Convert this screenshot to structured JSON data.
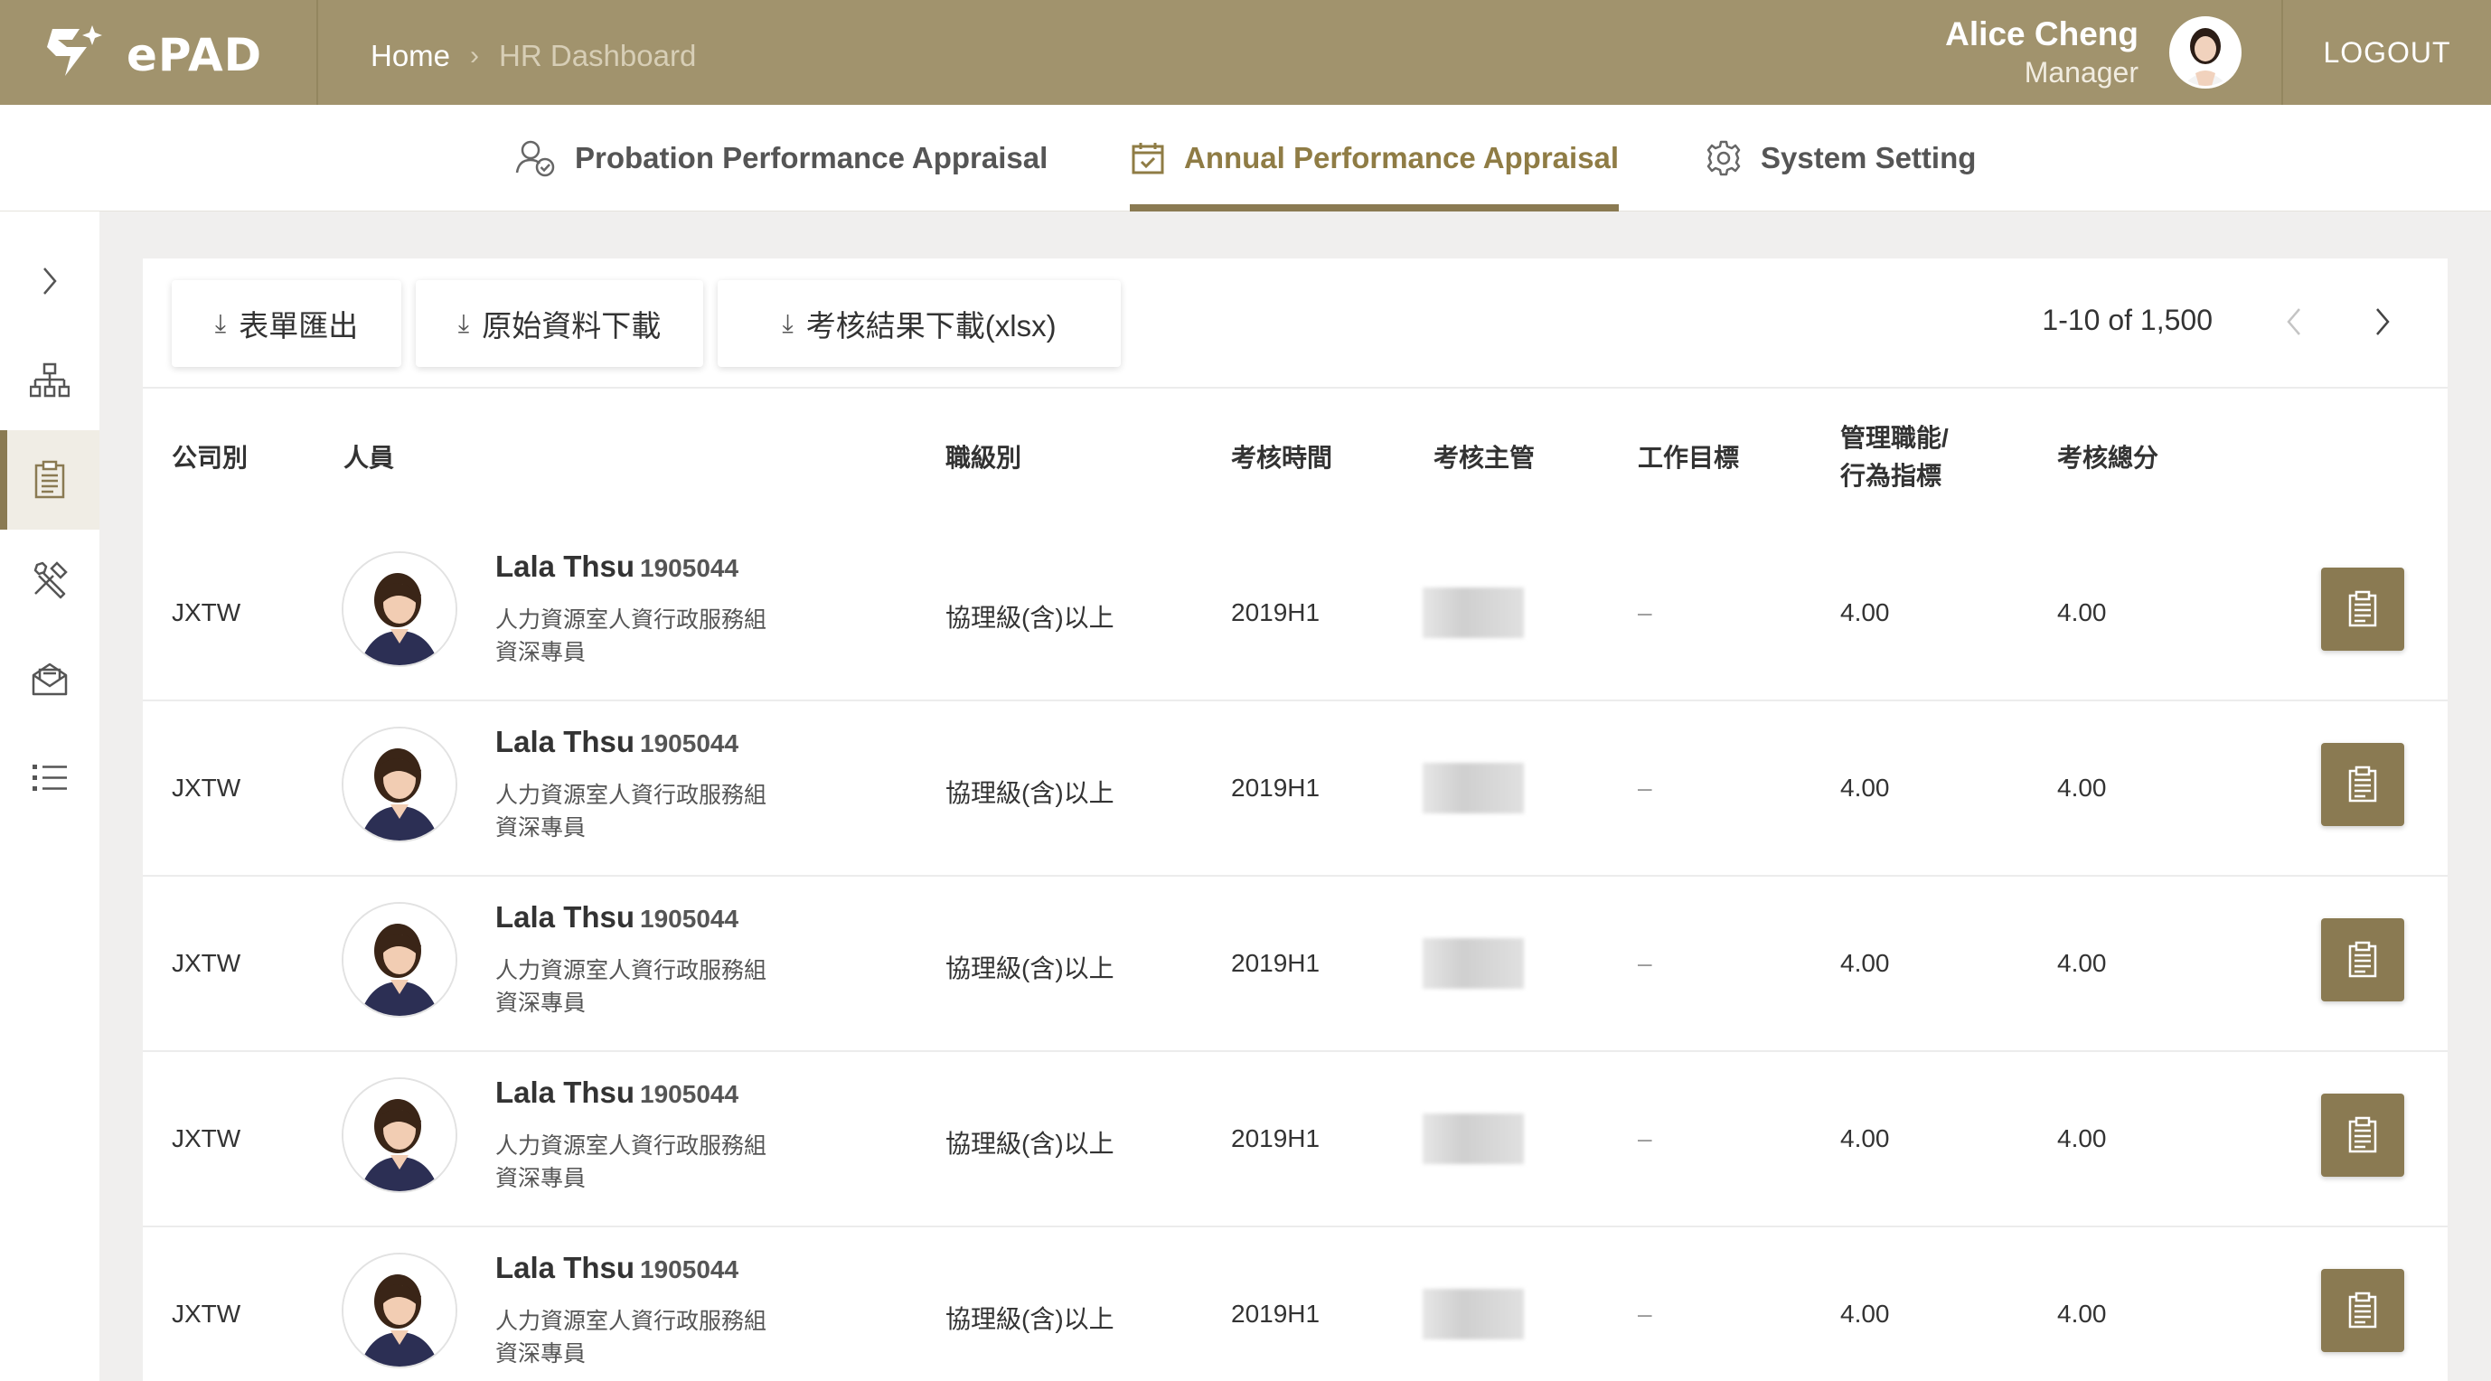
{
  "header": {
    "logo_text": "ePAD",
    "breadcrumb": {
      "home": "Home",
      "current": "HR Dashboard"
    },
    "user": {
      "name": "Alice Cheng",
      "role": "Manager"
    },
    "logout_label": "LOGOUT",
    "colors": {
      "brand": "#a1936d",
      "accent": "#8a7a52"
    }
  },
  "tabs": [
    {
      "label": "Probation Performance Appraisal",
      "icon": "user-check-icon"
    },
    {
      "label": "Annual Performance Appraisal",
      "icon": "calendar-check-icon",
      "active": true
    },
    {
      "label": "System Setting",
      "icon": "gear-icon"
    }
  ],
  "sidebar": {
    "items": [
      {
        "icon": "chevron-right-icon"
      },
      {
        "icon": "org-chart-icon"
      },
      {
        "icon": "clipboard-icon",
        "active": true
      },
      {
        "icon": "tools-icon"
      },
      {
        "icon": "mail-open-icon"
      },
      {
        "icon": "list-icon"
      }
    ]
  },
  "toolbar": {
    "buttons": [
      "表單匯出",
      "原始資料下載",
      "考核結果下載(xlsx)"
    ],
    "pagination": "1-10 of 1,500"
  },
  "table": {
    "headers": {
      "company": "公司別",
      "person": "人員",
      "grade": "職級別",
      "period": "考核時間",
      "supervisor": "考核主管",
      "goals": "工作目標",
      "mgmt_line1": "管理職能/",
      "mgmt_line2": "行為指標",
      "total": "考核總分"
    },
    "rows": [
      {
        "company": "JXTW",
        "name": "Lala Thsu",
        "id": "1905044",
        "dept": "人力資源室人資行政服務組",
        "title": "資深專員",
        "grade": "協理級(含)以上",
        "period": "2019H1",
        "goals": "–",
        "mgmt": "4.00",
        "total": "4.00"
      },
      {
        "company": "JXTW",
        "name": "Lala Thsu",
        "id": "1905044",
        "dept": "人力資源室人資行政服務組",
        "title": "資深專員",
        "grade": "協理級(含)以上",
        "period": "2019H1",
        "goals": "–",
        "mgmt": "4.00",
        "total": "4.00"
      },
      {
        "company": "JXTW",
        "name": "Lala Thsu",
        "id": "1905044",
        "dept": "人力資源室人資行政服務組",
        "title": "資深專員",
        "grade": "協理級(含)以上",
        "period": "2019H1",
        "goals": "–",
        "mgmt": "4.00",
        "total": "4.00"
      },
      {
        "company": "JXTW",
        "name": "Lala Thsu",
        "id": "1905044",
        "dept": "人力資源室人資行政服務組",
        "title": "資深專員",
        "grade": "協理級(含)以上",
        "period": "2019H1",
        "goals": "–",
        "mgmt": "4.00",
        "total": "4.00"
      },
      {
        "company": "JXTW",
        "name": "Lala Thsu",
        "id": "1905044",
        "dept": "人力資源室人資行政服務組",
        "title": "資深專員",
        "grade": "協理級(含)以上",
        "period": "2019H1",
        "goals": "–",
        "mgmt": "4.00",
        "total": "4.00"
      }
    ]
  }
}
